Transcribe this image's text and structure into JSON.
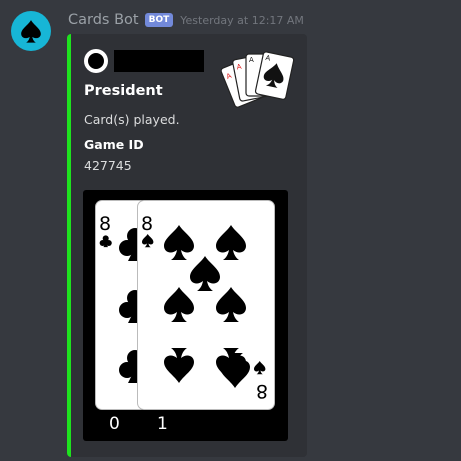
{
  "message": {
    "author": "Cards Bot",
    "bot_tag": "BOT",
    "timestamp": "Yesterday at 12:17 AM",
    "avatar_icon": "spade-icon"
  },
  "embed": {
    "accent_color": "#1ee31e",
    "author_icon": "circle-avatar-icon",
    "title": "President",
    "description": "Card(s) played.",
    "fields": [
      {
        "name": "Game ID",
        "value": "427745"
      }
    ],
    "thumbnail_icon": "playing-cards-fan-icon",
    "image": {
      "cards": [
        {
          "rank": "8",
          "suit": "clubs",
          "index_label": "0"
        },
        {
          "rank": "8",
          "suit": "spades",
          "index_label": "1"
        }
      ]
    }
  },
  "colors": {
    "background": "#36393f",
    "embed_background": "#2f3136",
    "bot_tag": "#7289da",
    "avatar": "#17b6d6"
  }
}
